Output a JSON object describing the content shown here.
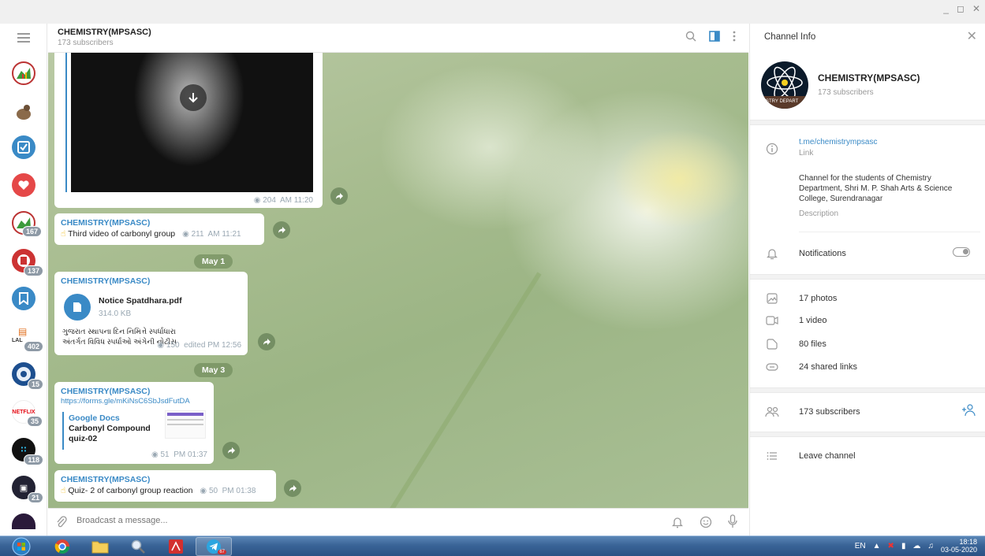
{
  "chat": {
    "title": "CHEMISTRY(MPSASC)",
    "subtitle": "173 subscribers",
    "messages": [
      {
        "views": "204",
        "time": "AM 11:20"
      },
      {
        "sender": "CHEMISTRY(MPSASC)",
        "text": "Third video of carbonyl group",
        "views": "211",
        "time": "AM 11:21"
      },
      {
        "date": "May 1"
      },
      {
        "sender": "CHEMISTRY(MPSASC)",
        "file_name": "Notice Spatdhara.pdf",
        "file_size": "314.0 KB",
        "text": "ગુજરાત સ્થાપના દિન નિમિત્તે સ્પર્ધાધારા અંતર્ગત વિવિધ સ્પર્ધાઓ અંગેની નોટીસ",
        "views": "150",
        "time": "edited PM 12:56"
      },
      {
        "date": "May 3"
      },
      {
        "sender": "CHEMISTRY(MPSASC)",
        "link": "https://forms.gle/mKiNsC6SbJsdFutDA",
        "preview_site": "Google Docs",
        "preview_title": "Carbonyl Compound quiz-02",
        "views": "51",
        "time": "PM 01:37"
      },
      {
        "sender": "CHEMISTRY(MPSASC)",
        "text": "Quiz- 2 of carbonyl group reaction",
        "views": "50",
        "time": "PM 01:38"
      }
    ]
  },
  "input": {
    "placeholder": "Broadcast a message..."
  },
  "sidebar_badges": [
    "167",
    "137",
    "402",
    "15",
    "35",
    "118",
    "21"
  ],
  "sidebar_labels": {
    "netflix": "NETFLIX",
    "lal": "LAL"
  },
  "info": {
    "title": "Channel Info",
    "name": "CHEMISTRY(MPSASC)",
    "subscribers": "173 subscribers",
    "link": "t.me/chemistrympsasc",
    "link_label": "Link",
    "description": "Channel for the students of Chemistry Department, Shri M. P. Shah Arts & Science College, Surendranagar",
    "description_label": "Description",
    "notifications": "Notifications",
    "notifications_on": false,
    "photos": "17 photos",
    "video": "1 video",
    "files": "80 files",
    "links": "24 shared links",
    "subs_row": "173 subscribers",
    "leave": "Leave channel",
    "avatar_text": "STRY DEPART"
  },
  "taskbar": {
    "lang": "EN",
    "time": "18:18",
    "date": "03-05-2020",
    "telegram_badge": "67"
  },
  "colors": {
    "accent": "#3a8ac6",
    "taskbar": "#2a5284",
    "wallpaper": "#a7bc8f"
  }
}
